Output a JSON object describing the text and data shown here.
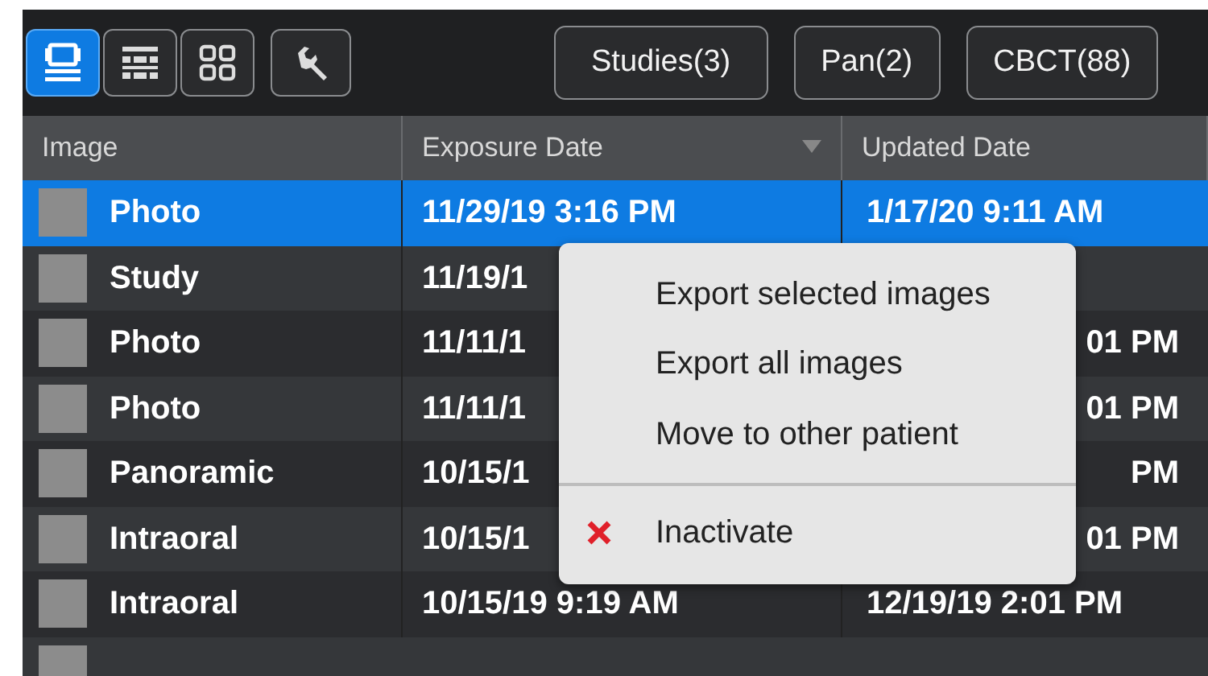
{
  "toolbar": {
    "view_buttons": [
      {
        "kind": "single",
        "selected": true
      },
      {
        "kind": "rows",
        "selected": false
      },
      {
        "kind": "grid",
        "selected": false
      }
    ],
    "tool_button": {
      "kind": "wrench"
    },
    "filter_buttons": [
      {
        "label": "Studies(3)"
      },
      {
        "label": "Pan(2)"
      },
      {
        "label": "CBCT(88)"
      }
    ]
  },
  "table": {
    "columns": [
      {
        "label": "Image",
        "sorted": false
      },
      {
        "label": "Exposure Date",
        "sorted": true
      },
      {
        "label": "Updated Date",
        "sorted": false
      }
    ],
    "rows": [
      {
        "type": "Photo",
        "exposure": "11/29/19 3:16 PM",
        "updated": "1/17/20 9:11 AM",
        "selected": true,
        "covered": false
      },
      {
        "type": "Study",
        "exposure": "11/19/1",
        "selected": false
      },
      {
        "type": "Photo",
        "exposure": "11/11/1",
        "updated": "01 PM",
        "selected": false,
        "covered": true
      },
      {
        "type": "Photo",
        "exposure": "11/11/1",
        "updated": "01 PM",
        "selected": false,
        "covered": true
      },
      {
        "type": "Panoramic",
        "exposure": "10/15/1",
        "updated": "PM",
        "selected": false,
        "covered": true
      },
      {
        "type": "Intraoral",
        "exposure": "10/15/1",
        "updated": "01 PM",
        "selected": false,
        "covered": true
      },
      {
        "type": "Intraoral",
        "exposure": "10/15/19 9:19 AM",
        "updated": "12/19/19 2:01 PM",
        "selected": false,
        "covered": false
      }
    ]
  },
  "context_menu": {
    "items": [
      {
        "kind": "plain",
        "label": "Export selected images"
      },
      {
        "kind": "plain",
        "label": "Export all images"
      },
      {
        "kind": "plain",
        "label": "Move to other patient"
      },
      {
        "kind": "separator"
      },
      {
        "kind": "danger",
        "label": "Inactivate"
      }
    ]
  }
}
